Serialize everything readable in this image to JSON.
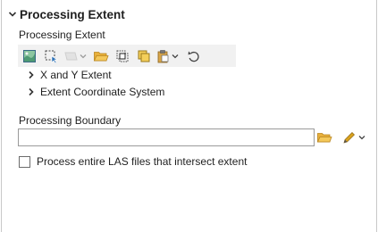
{
  "section": {
    "title": "Processing Extent",
    "expanded": true,
    "chevron_icon": "chevron-down-icon"
  },
  "extent": {
    "label": "Processing Extent",
    "toolbar": [
      {
        "name": "extent-of-current-display-button",
        "icon": "map-extent-icon",
        "enabled": true
      },
      {
        "name": "draw-extent-button",
        "icon": "draw-rectangle-icon",
        "enabled": true
      },
      {
        "name": "extent-from-layer-dropdown",
        "icon": "layer-dropdown-icon",
        "enabled": false
      },
      {
        "name": "browse-extent-button",
        "icon": "folder-icon",
        "enabled": true
      },
      {
        "name": "intersection-of-inputs-button",
        "icon": "intersection-icon",
        "enabled": true
      },
      {
        "name": "union-of-inputs-button",
        "icon": "union-icon",
        "enabled": true
      },
      {
        "name": "paste-extent-dropdown",
        "icon": "clipboard-icon",
        "enabled": true
      },
      {
        "name": "reset-extent-button",
        "icon": "undo-icon",
        "enabled": true
      }
    ],
    "tree": [
      {
        "label": "X and Y Extent",
        "expanded": false
      },
      {
        "label": "Extent Coordinate System",
        "expanded": false
      }
    ]
  },
  "boundary": {
    "label": "Processing Boundary",
    "value": "",
    "placeholder": ""
  },
  "options": {
    "process_entire_las": {
      "label": "Process entire LAS files that intersect extent",
      "checked": false
    }
  },
  "colors": {
    "folder": "#e8b03c",
    "pencil": "#d9a21f",
    "border": "#9a9a9a",
    "toolbar_bg": "#f1f1f1"
  }
}
